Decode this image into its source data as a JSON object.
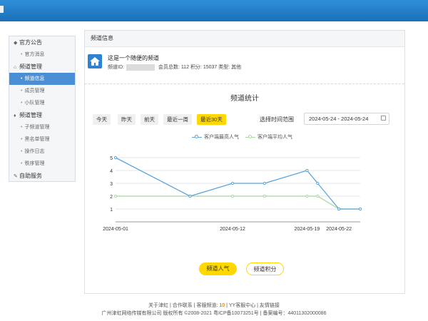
{
  "sidebar": {
    "groups": [
      {
        "icon": "megaphone-icon",
        "label": "官方公告",
        "items": [
          "官方消息"
        ]
      },
      {
        "icon": "home-icon",
        "label": "频道管理",
        "items": [
          "频道信息",
          "成员管理",
          "小队管理"
        ]
      },
      {
        "icon": "shield-icon",
        "label": "子频道管理",
        "items": [
          "子频道管理",
          "黑名单管理",
          "操作日志",
          "秩序管理"
        ]
      },
      {
        "icon": "wrench-icon",
        "label": "自助服务",
        "items": []
      }
    ],
    "group3_label": "频道管理",
    "active_item": "频道信息"
  },
  "panel": {
    "title": "频道信息",
    "channel": {
      "name": "这是一个随便的频道",
      "id_label": "频道ID:",
      "members_label": "会员总数:",
      "members": "112",
      "points_label": "积分:",
      "points": "15037",
      "type_label": "类型:",
      "type": "其他"
    }
  },
  "stats": {
    "title": "频道统计",
    "range_buttons": [
      "今天",
      "昨天",
      "前天",
      "最近一周",
      "最近30天"
    ],
    "active_range": "最近30天",
    "range_label": "选择时间范围",
    "date_range": "2024-05-24 - 2024-05-24",
    "legend": [
      "客户端最高人气",
      "客户端平均人气"
    ]
  },
  "chart_data": {
    "type": "line",
    "x": [
      "2024-05-01",
      "2024-05-08",
      "2024-05-12",
      "2024-05-15",
      "2024-05-19",
      "2024-05-20",
      "2024-05-22",
      "2024-05-24"
    ],
    "tick_labels": [
      "2024-05-01",
      "2024-05-12",
      "2024-05-19",
      "2024-05-22"
    ],
    "ylim": [
      0,
      5
    ],
    "yticks": [
      1,
      2,
      3,
      4,
      5
    ],
    "series": [
      {
        "name": "客户端最高人气",
        "color": "#5aa5dc",
        "values": [
          5,
          2,
          3,
          3,
          4,
          3,
          1,
          1
        ]
      },
      {
        "name": "客户端平均人气",
        "color": "#a8d8a0",
        "values": [
          2,
          2,
          2,
          2,
          2,
          2,
          1,
          1
        ]
      }
    ],
    "grid": true,
    "legend_position": "top-center"
  },
  "actions": {
    "primary": "频道人气",
    "secondary": "频道积分"
  },
  "footer": {
    "line1_pre": "关于津虹 | 合作联系 | 客服频道:",
    "channel_num": "10",
    "line1_post": "| YY客服中心 | 友情链接",
    "line2": "广州津虹网络传媒有限公司 版权所有 ©2008-2021 粤ICP备10073251号 | 备案编号：44011302000086"
  }
}
